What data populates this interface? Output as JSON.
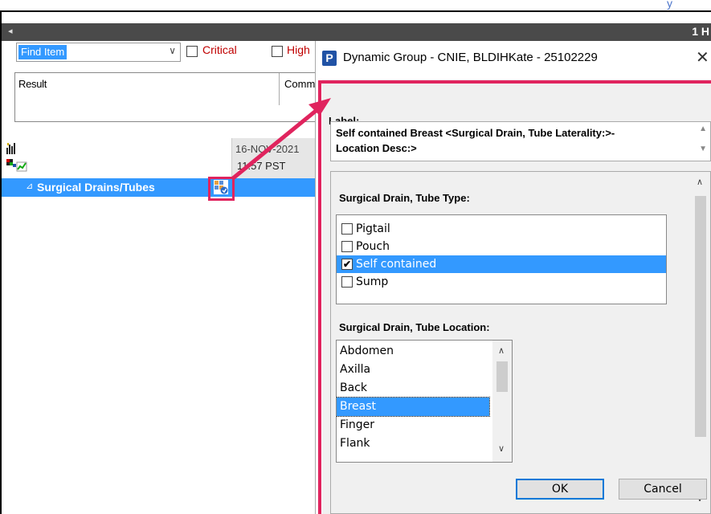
{
  "app": {
    "corner_text": "y",
    "bar_right_text": "1 H",
    "bar_left_glyph": "◂"
  },
  "filters": {
    "find_item": "Find Item",
    "critical_label": "Critical",
    "high_label": "High"
  },
  "results_header": {
    "result_label": "Result",
    "comment_label": "Comm"
  },
  "grid": {
    "date": "16-NOV-2021",
    "time": "11:57 PST",
    "row_label": "Surgical Drains/Tubes",
    "row_glyph": "⊿"
  },
  "dialog": {
    "badge": "P",
    "title": "Dynamic Group - CNIE, BLDIHKate - 25102229",
    "close_glyph": "✕",
    "label_heading": "Label:",
    "label_line1": "Self contained Breast <Surgical Drain, Tube Laterality:>-",
    "label_line2": "Location Desc:>",
    "type_heading": "Surgical Drain, Tube Type:",
    "type_options": [
      {
        "label": "Pigtail",
        "checked": false
      },
      {
        "label": "Pouch",
        "checked": false
      },
      {
        "label": "Self contained",
        "checked": true
      },
      {
        "label": "Sump",
        "checked": false
      }
    ],
    "location_heading": "Surgical Drain, Tube Location:",
    "location_options": [
      "Abdomen",
      "Axilla",
      "Back",
      "Breast",
      "Finger",
      "Flank"
    ],
    "location_selected": "Breast",
    "ok_label": "OK",
    "cancel_label": "Cancel"
  },
  "colors": {
    "highlight": "#e0245e",
    "selection": "#3399ff",
    "badge": "#2052a5"
  }
}
